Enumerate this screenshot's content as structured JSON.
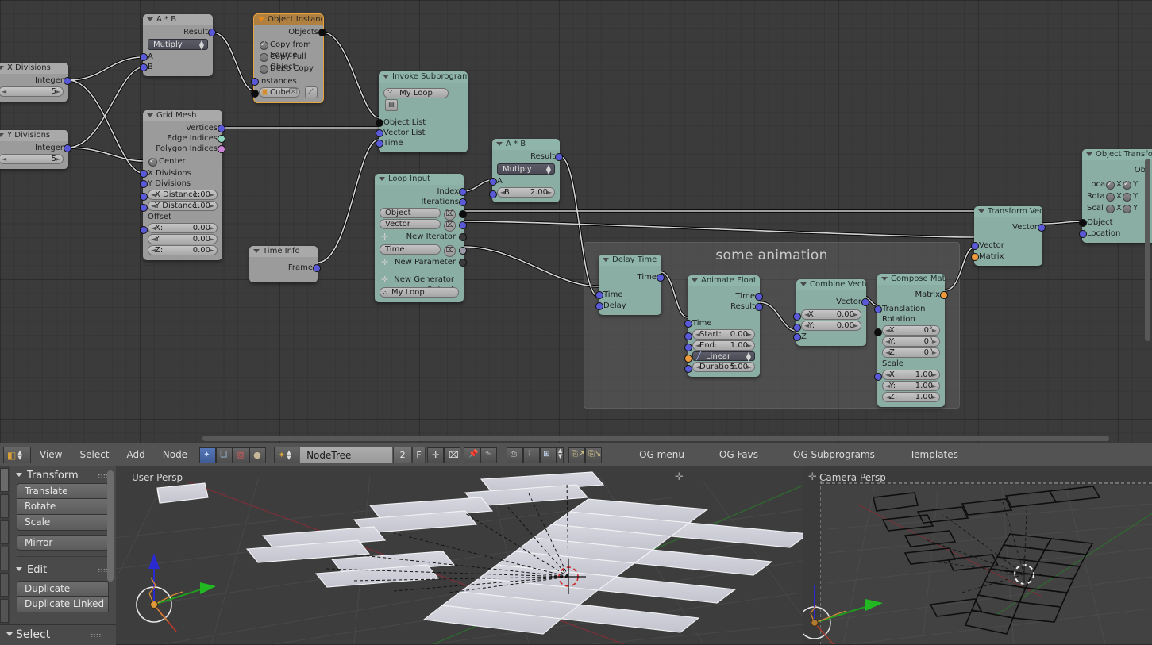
{
  "node_editor": {
    "frame": {
      "label": "some animation"
    },
    "nodes": [
      {
        "id": "ab1",
        "title": "A * B",
        "type": "grey",
        "outputs": [
          "Result"
        ],
        "dropdown": "Mutiply",
        "inputs": [
          "A",
          "B"
        ]
      },
      {
        "id": "xdiv",
        "title": "X Divisions",
        "type": "grey",
        "outputs": [
          "Integer"
        ],
        "value": "5"
      },
      {
        "id": "ydiv",
        "title": "Y Divisions",
        "type": "grey",
        "outputs": [
          "Integer"
        ],
        "value": "5"
      },
      {
        "id": "objinst",
        "title": "Object Instancer",
        "type": "grey",
        "selected": true,
        "outputs": [
          "Objects"
        ],
        "radios": [
          {
            "label": "Copy from Source",
            "on": true
          },
          {
            "label": "Copy Full Object",
            "on": false
          },
          {
            "label": "Deep Copy",
            "on": false
          }
        ],
        "inputs": [
          "Instances"
        ],
        "object_field": "Cube"
      },
      {
        "id": "gridmesh",
        "title": "Grid Mesh",
        "type": "grey",
        "outputs": [
          "Vertices",
          "Edge Indices",
          "Polygon Indices"
        ],
        "checkbox": {
          "label": "Center",
          "on": true
        },
        "inputs": [
          "X Divisions",
          "Y Divisions"
        ],
        "fields": [
          {
            "name": "X Distance:",
            "value": "1.00"
          },
          {
            "name": "Y Distance:",
            "value": "1.00"
          }
        ],
        "offset_label": "Offset",
        "offset": [
          {
            "name": "X:",
            "value": "0.00"
          },
          {
            "name": "Y:",
            "value": "0.00"
          },
          {
            "name": "Z:",
            "value": "0.00"
          }
        ]
      },
      {
        "id": "invoke",
        "title": "Invoke Subprogram",
        "type": "green",
        "subprogram": "My Loop",
        "inputs": [
          "Object List",
          "Vector List",
          "Time"
        ]
      },
      {
        "id": "loopin",
        "title": "Loop Input",
        "type": "green",
        "outputs": [
          "Index",
          "Iterations"
        ],
        "iterators": [
          "Object",
          "Vector"
        ],
        "new_iterator": "New Iterator",
        "parameters": [
          "Time"
        ],
        "new_parameter": "New Parameter",
        "new_generator": "New Generator Output",
        "subprogram": "My Loop"
      },
      {
        "id": "timeinfo",
        "title": "Time Info",
        "type": "grey",
        "outputs": [
          "Frame"
        ]
      },
      {
        "id": "ab2",
        "title": "A * B",
        "type": "green",
        "outputs": [
          "Result"
        ],
        "dropdown": "Mutiply",
        "inputs": [
          "A"
        ],
        "fields": [
          {
            "name": "B:",
            "value": "2.00"
          }
        ]
      },
      {
        "id": "delay",
        "title": "Delay Time",
        "type": "green",
        "outputs": [
          "Time"
        ],
        "inputs": [
          "Time",
          "Delay"
        ]
      },
      {
        "id": "animfloat",
        "title": "Animate Float",
        "type": "green",
        "outputs": [
          "Time",
          "Result"
        ],
        "inputs": [
          "Time"
        ],
        "fields": [
          {
            "name": "Start:",
            "value": "0.00"
          },
          {
            "name": "End:",
            "value": "1.00"
          }
        ],
        "interpolation": "Linear",
        "duration": {
          "name": "Duration:",
          "value": "5.00"
        }
      },
      {
        "id": "combvec",
        "title": "Combine Vector",
        "type": "green",
        "outputs": [
          "Vector"
        ],
        "fields": [
          {
            "name": "X:",
            "value": "0.00"
          },
          {
            "name": "Y:",
            "value": "0.00"
          }
        ],
        "inputs": [
          "Z"
        ]
      },
      {
        "id": "composemat",
        "title": "Compose Matrix",
        "type": "green",
        "outputs": [
          "Matrix"
        ],
        "translation_label": "Translation",
        "rotation_label": "Rotation",
        "rotation": [
          {
            "name": "X:",
            "value": "0°"
          },
          {
            "name": "Y:",
            "value": "0°"
          },
          {
            "name": "Z:",
            "value": "0°"
          }
        ],
        "scale_label": "Scale",
        "scale": [
          {
            "name": "X:",
            "value": "1.00"
          },
          {
            "name": "Y:",
            "value": "1.00"
          },
          {
            "name": "Z:",
            "value": "1.00"
          }
        ]
      },
      {
        "id": "tvec",
        "title": "Transform Vector",
        "type": "green",
        "outputs": [
          "Vector"
        ],
        "inputs": [
          "Vector",
          "Matrix"
        ]
      },
      {
        "id": "objtrans",
        "title": "Object Transform",
        "type": "green",
        "outputs": [
          "Ob"
        ],
        "rows": [
          {
            "label": "Loca",
            "x": "X",
            "y": "Y",
            "on": true
          },
          {
            "label": "Rota",
            "x": "X",
            "y": "Y",
            "on": false
          },
          {
            "label": "Scal",
            "x": "X",
            "y": "Y",
            "on": false
          }
        ],
        "inputs": [
          "Object",
          "Location"
        ]
      }
    ]
  },
  "header": {
    "editor_type_icon": "node-editor-icon",
    "menus": [
      "View",
      "Select",
      "Add",
      "Node"
    ],
    "mode_icons": [
      "shading-icon",
      "snap-copy-icon",
      "texture-icon",
      "material-icon"
    ],
    "datablock_icon": "node-tree-icon",
    "tree_name": "NodeTree",
    "users_count": "2",
    "fake_user": "F",
    "new_button": "new-datablock-icon",
    "unlink_button": "unlink-datablock-icon",
    "pin_button": "pin-icon",
    "goto_parent_button": "go-to-parent-icon",
    "use_nodes_icon": "use-nodes-icon",
    "backdrop_icon": "backdrop-icon",
    "snap_icon": "snap-grid-icon",
    "copy_icon": "copy-to-clipboard-icon",
    "paste_icon": "paste-from-clipboard-icon",
    "addon_menus": [
      "OG menu",
      "OG Favs",
      "OG Subprograms",
      "Templates"
    ]
  },
  "tool_shelf": {
    "panels": [
      {
        "title": "Transform",
        "buttons": [
          "Translate",
          "Rotate",
          "Scale"
        ],
        "extra": [
          "Mirror"
        ]
      },
      {
        "title": "Edit",
        "buttons": [
          "Duplicate",
          "Duplicate Linked"
        ]
      }
    ],
    "footer_panel": "Select"
  },
  "viewports": [
    {
      "label": "User Persp",
      "shading": "solid"
    },
    {
      "label": "Camera Persp",
      "shading": "wireframe"
    }
  ],
  "colors": {
    "background": "#3b3b3b",
    "node_grey": "#9b9b9b",
    "node_green": "#8aada4",
    "selected_outline": "#e8a33d",
    "socket_blue": "#5a5ad8",
    "socket_green": "#8fd5bd",
    "socket_purple": "#cc84d6",
    "socket_orange": "#ed9a3c",
    "header": "#535353"
  }
}
